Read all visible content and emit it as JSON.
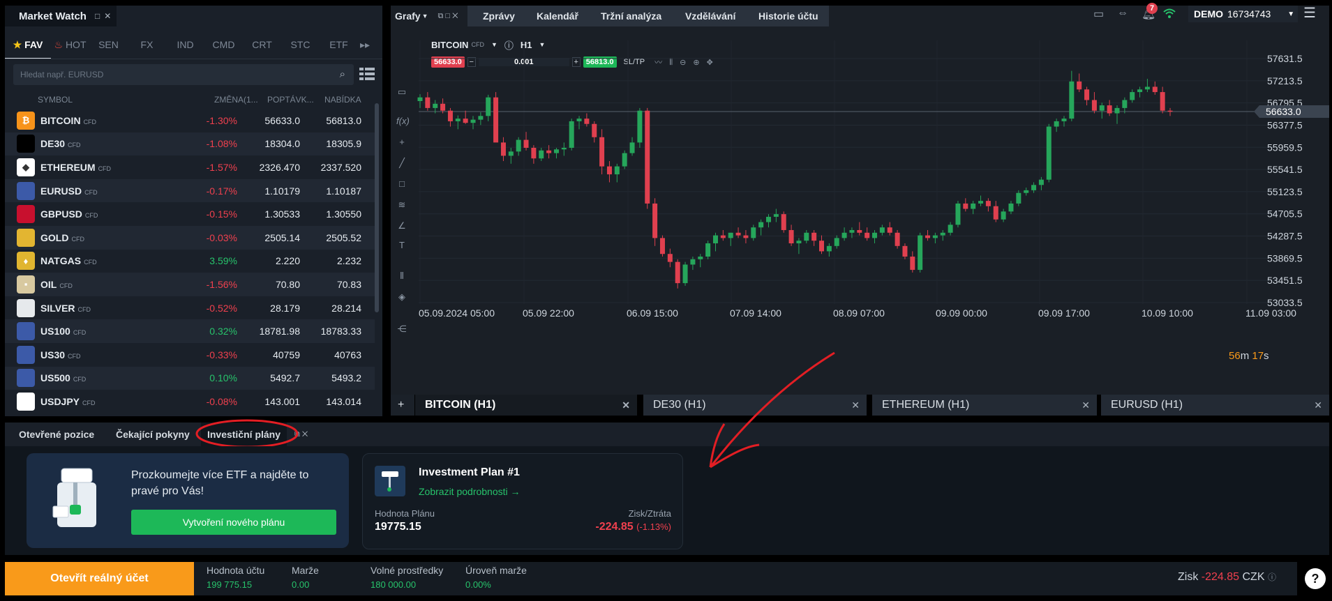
{
  "market_watch": {
    "title": "Market Watch",
    "tabs": [
      "FAV",
      "HOT",
      "SEN",
      "FX",
      "IND",
      "CMD",
      "CRT",
      "STC",
      "ETF"
    ],
    "search_placeholder": "Hledat např. EURUSD",
    "columns": {
      "symbol": "SYMBOL",
      "change": "ZMĚNA(1...",
      "bid": "POPTÁVK...",
      "ask": "NABÍDKA"
    },
    "rows": [
      {
        "symbol": "BITCOIN",
        "tag": "CFD",
        "change": "-1.30%",
        "bid": "56633.0",
        "ask": "56813.0",
        "dir": "neg",
        "icon": "bitcoin-icon",
        "color": "#f7931a",
        "glyph": "₿"
      },
      {
        "symbol": "DE30",
        "tag": "CFD",
        "change": "-1.08%",
        "bid": "18304.0",
        "ask": "18305.9",
        "dir": "neg",
        "icon": "germany-flag-icon",
        "color": "#000000",
        "glyph": ""
      },
      {
        "symbol": "ETHEREUM",
        "tag": "CFD",
        "change": "-1.57%",
        "bid": "2326.470",
        "ask": "2337.520",
        "dir": "neg",
        "icon": "ethereum-icon",
        "color": "#ffffff",
        "glyph": "◆"
      },
      {
        "symbol": "EURUSD",
        "tag": "CFD",
        "change": "-0.17%",
        "bid": "1.10179",
        "ask": "1.10187",
        "dir": "neg",
        "icon": "eu-us-flag-icon",
        "color": "#3c5aa8",
        "glyph": ""
      },
      {
        "symbol": "GBPUSD",
        "tag": "CFD",
        "change": "-0.15%",
        "bid": "1.30533",
        "ask": "1.30550",
        "dir": "neg",
        "icon": "uk-us-flag-icon",
        "color": "#c8102e",
        "glyph": ""
      },
      {
        "symbol": "GOLD",
        "tag": "CFD",
        "change": "-0.03%",
        "bid": "2505.14",
        "ask": "2505.52",
        "dir": "neg",
        "icon": "gold-icon",
        "color": "#e3b531",
        "glyph": ""
      },
      {
        "symbol": "NATGAS",
        "tag": "CFD",
        "change": "3.59%",
        "bid": "2.220",
        "ask": "2.232",
        "dir": "pos",
        "icon": "gas-flame-icon",
        "color": "#e0b530",
        "glyph": "♦"
      },
      {
        "symbol": "OIL",
        "tag": "CFD",
        "change": "-1.56%",
        "bid": "70.80",
        "ask": "70.83",
        "dir": "neg",
        "icon": "oil-barrel-icon",
        "color": "#d8c9a0",
        "glyph": "▪"
      },
      {
        "symbol": "SILVER",
        "tag": "CFD",
        "change": "-0.52%",
        "bid": "28.179",
        "ask": "28.214",
        "dir": "neg",
        "icon": "silver-icon",
        "color": "#e6e9ec",
        "glyph": ""
      },
      {
        "symbol": "US100",
        "tag": "CFD",
        "change": "0.32%",
        "bid": "18781.98",
        "ask": "18783.33",
        "dir": "pos",
        "icon": "us-flag-icon",
        "color": "#3c5aa8",
        "glyph": ""
      },
      {
        "symbol": "US30",
        "tag": "CFD",
        "change": "-0.33%",
        "bid": "40759",
        "ask": "40763",
        "dir": "neg",
        "icon": "us-flag-icon",
        "color": "#3c5aa8",
        "glyph": ""
      },
      {
        "symbol": "US500",
        "tag": "CFD",
        "change": "0.10%",
        "bid": "5492.7",
        "ask": "5493.2",
        "dir": "pos",
        "icon": "us-flag-icon",
        "color": "#3c5aa8",
        "glyph": ""
      },
      {
        "symbol": "USDJPY",
        "tag": "CFD",
        "change": "-0.08%",
        "bid": "143.001",
        "ask": "143.014",
        "dir": "neg",
        "icon": "us-jp-flag-icon",
        "color": "#ffffff",
        "glyph": ""
      }
    ]
  },
  "topbar": {
    "grafy": "Grafy",
    "menu": [
      "Zprávy",
      "Kalendář",
      "Tržní analýza",
      "Vzdělávání",
      "Historie účtu"
    ],
    "notifications": "7",
    "account_mode": "DEMO",
    "account_id": "16734743"
  },
  "chart_header": {
    "symbol": "BITCOIN",
    "tag": "CFD",
    "timeframe": "H1",
    "sell": "56633.0",
    "volume": "0.001",
    "buy": "56813.0",
    "sltp": "SL/TP",
    "countdown_min": "56",
    "countdown_m": "m",
    "countdown_sec": "17",
    "countdown_s": "s"
  },
  "chart_data": {
    "type": "candlestick",
    "y_ticks": [
      "57631.5",
      "57213.5",
      "56795.5",
      "56377.5",
      "55959.5",
      "55541.5",
      "55123.5",
      "54705.5",
      "54287.5",
      "53869.5",
      "53451.5",
      "53033.5"
    ],
    "x_ticks": [
      "05.09.2024 05:00",
      "05.09 22:00",
      "06.09 15:00",
      "07.09 14:00",
      "08.09 07:00",
      "09.09 00:00",
      "09.09 17:00",
      "10.09 10:00",
      "11.09 03:00"
    ],
    "ylim": [
      53033.5,
      57850
    ],
    "current_price": "56633.0",
    "current_value": 56633.0,
    "colors": {
      "up": "#26a65b",
      "down": "#e0404f"
    },
    "candles": [
      [
        56830,
        56960,
        56700,
        56900
      ],
      [
        56900,
        57000,
        56650,
        56700
      ],
      [
        56700,
        56850,
        56600,
        56780
      ],
      [
        56780,
        56880,
        56600,
        56650
      ],
      [
        56650,
        56700,
        56350,
        56450
      ],
      [
        56450,
        56560,
        56300,
        56500
      ],
      [
        56500,
        56650,
        56400,
        56420
      ],
      [
        56420,
        56550,
        56300,
        56480
      ],
      [
        56480,
        56620,
        56380,
        56550
      ],
      [
        56550,
        56950,
        56450,
        56900
      ],
      [
        56900,
        57000,
        56400,
        56050
      ],
      [
        56050,
        56150,
        55700,
        55800
      ],
      [
        55800,
        55950,
        55650,
        55880
      ],
      [
        55880,
        56150,
        55800,
        56100
      ],
      [
        56100,
        56250,
        55900,
        55950
      ],
      [
        55950,
        56000,
        55650,
        55750
      ],
      [
        55750,
        55950,
        55700,
        55900
      ],
      [
        55900,
        56000,
        55750,
        55850
      ],
      [
        55850,
        55950,
        55750,
        55920
      ],
      [
        55920,
        56050,
        55800,
        55950
      ],
      [
        55950,
        56500,
        55900,
        56450
      ],
      [
        56450,
        56550,
        56300,
        56500
      ],
      [
        56500,
        56600,
        56350,
        56400
      ],
      [
        56400,
        56450,
        56050,
        56150
      ],
      [
        56150,
        56300,
        55450,
        55600
      ],
      [
        55600,
        55700,
        55300,
        55450
      ],
      [
        55450,
        55650,
        55300,
        55600
      ],
      [
        55600,
        55900,
        55550,
        55850
      ],
      [
        55850,
        56150,
        55800,
        56050
      ],
      [
        56050,
        56700,
        55950,
        56650
      ],
      [
        56650,
        56700,
        54800,
        54900
      ],
      [
        54900,
        55000,
        54100,
        54250
      ],
      [
        54250,
        54300,
        53900,
        53950
      ],
      [
        53950,
        54050,
        53700,
        53800
      ],
      [
        53800,
        53850,
        53300,
        53400
      ],
      [
        53400,
        53800,
        53350,
        53750
      ],
      [
        53750,
        53900,
        53650,
        53850
      ],
      [
        53850,
        53950,
        53700,
        53900
      ],
      [
        53900,
        54200,
        53850,
        54150
      ],
      [
        54150,
        54350,
        54000,
        54300
      ],
      [
        54300,
        54400,
        54200,
        54250
      ],
      [
        54250,
        54350,
        54100,
        54350
      ],
      [
        54350,
        54450,
        54250,
        54300
      ],
      [
        54300,
        54400,
        54150,
        54250
      ],
      [
        54250,
        54500,
        54200,
        54450
      ],
      [
        54450,
        54600,
        54300,
        54550
      ],
      [
        54550,
        54700,
        54450,
        54650
      ],
      [
        54650,
        54800,
        54550,
        54700
      ],
      [
        54700,
        54750,
        54350,
        54400
      ],
      [
        54400,
        54500,
        54100,
        54150
      ],
      [
        54150,
        54250,
        53950,
        54200
      ],
      [
        54200,
        54400,
        54150,
        54350
      ],
      [
        54350,
        54400,
        54100,
        54200
      ],
      [
        54200,
        54300,
        53950,
        54000
      ],
      [
        54000,
        54150,
        53900,
        54100
      ],
      [
        54100,
        54300,
        54050,
        54250
      ],
      [
        54250,
        54450,
        54200,
        54350
      ],
      [
        54350,
        54450,
        54250,
        54400
      ],
      [
        54400,
        54550,
        54300,
        54350
      ],
      [
        54350,
        54450,
        54200,
        54250
      ],
      [
        54250,
        54400,
        54150,
        54350
      ],
      [
        54350,
        54500,
        54300,
        54450
      ],
      [
        54450,
        54550,
        54300,
        54350
      ],
      [
        54350,
        54400,
        54050,
        54100
      ],
      [
        54100,
        54150,
        53850,
        53900
      ],
      [
        53900,
        54000,
        53600,
        53650
      ],
      [
        53650,
        54350,
        53600,
        54300
      ],
      [
        54300,
        54400,
        54200,
        54250
      ],
      [
        54250,
        54350,
        54150,
        54300
      ],
      [
        54300,
        54400,
        54200,
        54350
      ],
      [
        54350,
        54550,
        54300,
        54500
      ],
      [
        54500,
        54950,
        54450,
        54900
      ],
      [
        54900,
        55000,
        54750,
        54800
      ],
      [
        54800,
        54950,
        54700,
        54900
      ],
      [
        54900,
        55050,
        54850,
        54950
      ],
      [
        54950,
        55000,
        54750,
        54850
      ],
      [
        54850,
        54950,
        54550,
        54600
      ],
      [
        54600,
        54800,
        54550,
        54750
      ],
      [
        54750,
        54950,
        54700,
        54900
      ],
      [
        54900,
        55150,
        54850,
        55100
      ],
      [
        55100,
        55200,
        55050,
        55150
      ],
      [
        55150,
        55300,
        55100,
        55250
      ],
      [
        55250,
        55400,
        55150,
        55350
      ],
      [
        55350,
        56400,
        55300,
        56350
      ],
      [
        56350,
        56500,
        56250,
        56450
      ],
      [
        56450,
        56550,
        56350,
        56500
      ],
      [
        56500,
        57400,
        56450,
        57200
      ],
      [
        57200,
        57350,
        57000,
        57050
      ],
      [
        57050,
        57100,
        56750,
        56850
      ],
      [
        56850,
        57000,
        56600,
        56650
      ],
      [
        56650,
        56800,
        56500,
        56750
      ],
      [
        56750,
        56850,
        56550,
        56600
      ],
      [
        56600,
        56750,
        56400,
        56700
      ],
      [
        56700,
        56900,
        56600,
        56850
      ],
      [
        56850,
        57050,
        56800,
        57000
      ],
      [
        57000,
        57100,
        56900,
        57050
      ],
      [
        57050,
        57250,
        57000,
        57100
      ],
      [
        57100,
        57200,
        56950,
        57000
      ],
      [
        57000,
        57100,
        56600,
        56650
      ],
      [
        56650,
        56700,
        56550,
        56633
      ]
    ]
  },
  "chart_tabs": [
    "BITCOIN (H1)",
    "DE30 (H1)",
    "ETHEREUM (H1)",
    "EURUSD (H1)"
  ],
  "panel_tabs": [
    "Otevřené pozice",
    "Čekající pokyny",
    "Investiční plány"
  ],
  "promo": {
    "text": "Prozkoumejte více ETF a najděte to pravé pro Vás!",
    "button": "Vytvoření nového plánu"
  },
  "plan": {
    "title": "Investment Plan #1",
    "link": "Zobrazit podrobnosti →",
    "value_label": "Hodnota Plánu",
    "value": "19775.15",
    "pl_label": "Zisk/Ztráta",
    "pl_value": "-224.85",
    "pl_pct": "(-1.13%)"
  },
  "footer": {
    "open_account": "Otevřít reálný účet",
    "stats": [
      {
        "label": "Hodnota účtu",
        "value": "199 775.15"
      },
      {
        "label": "Marže",
        "value": "0.00"
      },
      {
        "label": "Volné prostředky",
        "value": "180 000.00"
      },
      {
        "label": "Úroveň marže",
        "value": "0.00%"
      }
    ],
    "profit_label": "Zisk",
    "profit_value": "-224.85",
    "currency": "CZK",
    "help": "?"
  }
}
